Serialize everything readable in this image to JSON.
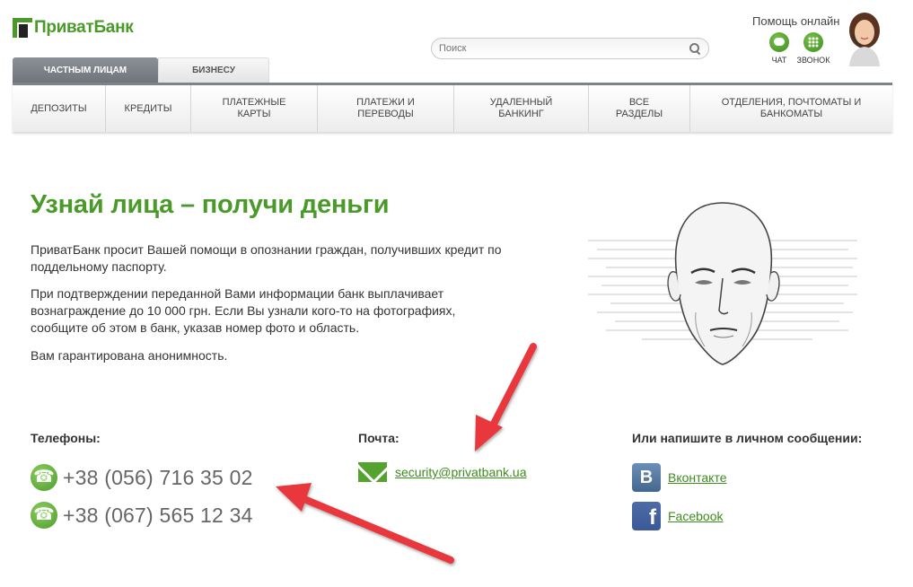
{
  "header": {
    "logo_text": "ПриватБанк",
    "search_placeholder": "Поиск",
    "help_title": "Помощь онлайн",
    "chat_label": "ЧАТ",
    "call_label": "ЗВОНОК"
  },
  "tabs": [
    {
      "label": "ЧАСТНЫМ ЛИЦАМ",
      "active": true
    },
    {
      "label": "БИЗНЕСУ",
      "active": false
    }
  ],
  "nav": [
    {
      "line1": "ДЕПОЗИТЫ",
      "line2": ""
    },
    {
      "line1": "КРЕДИТЫ",
      "line2": ""
    },
    {
      "line1": "ПЛАТЕЖНЫЕ",
      "line2": "КАРТЫ"
    },
    {
      "line1": "ПЛАТЕЖИ И",
      "line2": "ПЕРЕВОДЫ"
    },
    {
      "line1": "УДАЛЕННЫЙ",
      "line2": "БАНКИНГ"
    },
    {
      "line1": "ВСЕ",
      "line2": "РАЗДЕЛЫ"
    },
    {
      "line1": "ОТДЕЛЕНИЯ, ПОЧТОМАТЫ И",
      "line2": "БАНКОМАТЫ"
    }
  ],
  "main": {
    "headline": "Узнай лица – получи деньги",
    "paragraph1": "ПриватБанк просит Вашей помощи в опознании граждан, получивших кредит по поддельному паспорту.",
    "paragraph2": "При подтверждении переданной Вами информации банк выплачивает вознаграждение до 10 000 грн. Если Вы узнали кого-то на фотографиях, сообщите об этом в банк, указав номер фото и область.",
    "paragraph3": "Вам гарантирована анонимность."
  },
  "contacts": {
    "phones_title": "Телефоны:",
    "phones": [
      "+38 (056) 716 35 02",
      "+38 (067) 565 12 34"
    ],
    "mail_title": "Почта:",
    "email": "security@privatbank.ua",
    "message_title": "Или напишите в личном сообщении:",
    "vk_label": "Вконтакте",
    "fb_label": "Facebook"
  },
  "colors": {
    "brand_green": "#4a9a2a",
    "arrow_red": "#e8383d"
  }
}
